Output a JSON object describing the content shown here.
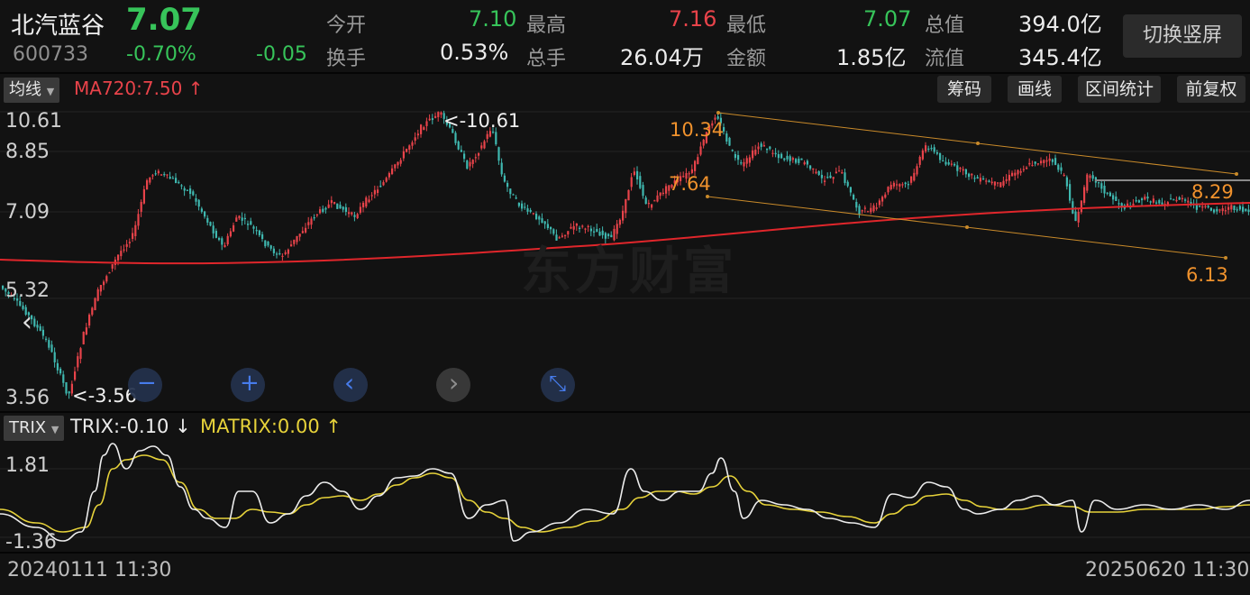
{
  "header": {
    "stock_name": "北汽蓝谷",
    "stock_code": "600733",
    "price": "7.07",
    "change_pct": "-0.70%",
    "change_abs": "-0.05",
    "stats": [
      {
        "label": "今开",
        "value": "7.10"
      },
      {
        "label": "最高",
        "value": "7.16"
      },
      {
        "label": "最低",
        "value": "7.07"
      },
      {
        "label": "总值",
        "value": "394.0亿"
      },
      {
        "label": "换手",
        "value": "0.53%"
      },
      {
        "label": "总手",
        "value": "26.04万"
      },
      {
        "label": "金额",
        "value": "1.85亿"
      },
      {
        "label": "流值",
        "value": "345.4亿"
      }
    ],
    "switch_button": "切换竖屏"
  },
  "toolbar": {
    "indicator_select": "均线",
    "ma_label": "MA720:7.50",
    "ma_arrow": "↑",
    "buttons": [
      "筹码",
      "画线",
      "区间统计",
      "前复权"
    ]
  },
  "main_chart": {
    "y_ticks": [
      "10.61",
      "8.85",
      "7.09",
      "5.32",
      "3.56"
    ],
    "max_marker": "<-10.61",
    "min_marker": "<-3.56",
    "channel_labels": [
      "10.34",
      "7.64",
      "8.29",
      "6.13"
    ],
    "watermark": "东方财富",
    "colors": {
      "up": "#e8434a",
      "down": "#3fb8b0",
      "ma": "#e0262b",
      "channel": "#c98a2a",
      "annotation": "#f0922d"
    }
  },
  "zoom_controls": [
    {
      "icon": "zoom-out-icon",
      "glyph": "−"
    },
    {
      "icon": "zoom-in-icon",
      "glyph": "+"
    },
    {
      "icon": "pan-left-icon",
      "glyph": "‹"
    },
    {
      "icon": "pan-right-icon",
      "glyph": "›"
    },
    {
      "icon": "reset-zoom-icon",
      "glyph": "⤡"
    }
  ],
  "collapse_icon": "chevron-left-icon",
  "sub_chart": {
    "indicator_select": "TRIX",
    "trix_label": "TRIX:-0.10",
    "trix_arrow": "↓",
    "matrix_label": "MATRIX:0.00",
    "matrix_arrow": "↑",
    "y_ticks": [
      "1.81",
      "-1.36"
    ],
    "colors": {
      "trix": "#ececec",
      "matrix": "#e6d23a"
    }
  },
  "footer": {
    "start_date": "20240111 11:30",
    "end_date": "20250620 11:30"
  }
}
